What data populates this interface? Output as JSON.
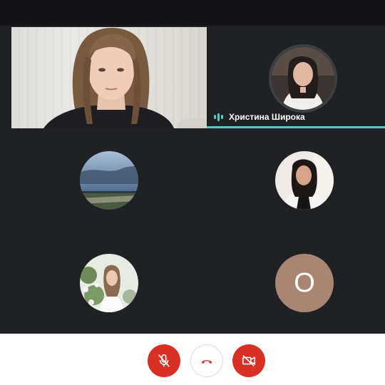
{
  "participants": {
    "active_speaker": {
      "name": "Христина Широка"
    },
    "letter_avatar": {
      "initial": "О",
      "color": "#a88673"
    }
  },
  "controls": {
    "mic": {
      "icon": "mic-off-icon",
      "state": "muted"
    },
    "hangup": {
      "icon": "phone-hangup-icon"
    },
    "camera": {
      "icon": "camera-off-icon",
      "state": "off"
    }
  },
  "colors": {
    "background": "#202124",
    "speaking_accent": "#4ecdc4",
    "danger": "#d93025",
    "control_bar": "#ffffff"
  }
}
